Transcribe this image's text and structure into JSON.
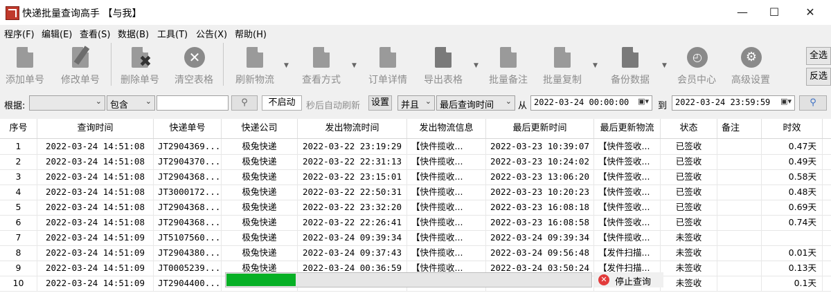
{
  "window": {
    "title": "快递批量查询高手  【与我】",
    "minimize_icon": "minimize-icon",
    "maximize_icon": "maximize-icon",
    "close_icon": "close-icon"
  },
  "menu": [
    "程序(F)",
    "编辑(E)",
    "查看(S)",
    "数据(B)",
    "工具(T)",
    "公告(X)",
    "帮助(H)"
  ],
  "toolbar": {
    "buttons": [
      {
        "label": "添加单号",
        "icon": "add-doc-icon"
      },
      {
        "label": "修改单号",
        "icon": "edit-doc-icon"
      },
      {
        "label": "删除单号",
        "icon": "delete-doc-icon"
      },
      {
        "label": "清空表格",
        "icon": "clear-table-icon"
      },
      {
        "label": "刷新物流",
        "icon": "refresh-doc-icon"
      },
      {
        "label": "查看方式",
        "icon": "view-mode-icon"
      },
      {
        "label": "订单详情",
        "icon": "order-detail-icon"
      },
      {
        "label": "导出表格",
        "icon": "export-icon"
      },
      {
        "label": "批量备注",
        "icon": "batch-note-icon"
      },
      {
        "label": "批量复制",
        "icon": "batch-copy-icon"
      },
      {
        "label": "备份数据",
        "icon": "backup-icon"
      },
      {
        "label": "会员中心",
        "icon": "member-icon"
      },
      {
        "label": "高级设置",
        "icon": "settings-gear-icon"
      }
    ],
    "select_all": "全选",
    "invert_select": "反选"
  },
  "filter": {
    "label": "根据:",
    "field_value": "",
    "match_value": "包含",
    "keyword_value": "",
    "search_icon": "search-icon",
    "auto_refresh_value": "不启动",
    "auto_refresh_label": "秒后自动刷新",
    "settings_button": "设置",
    "logic_value": "并且",
    "time_field_value": "最后查询时间",
    "from_label": "从",
    "from_value": "2022-03-24 00:00:00",
    "to_label": "到",
    "to_value": "2022-03-24 23:59:59"
  },
  "table": {
    "headers": [
      "序号",
      "查询时间",
      "快递单号",
      "快递公司",
      "发出物流时间",
      "发出物流信息",
      "最后更新时间",
      "最后更新物流",
      "状态",
      "备注",
      "时效"
    ],
    "rows": [
      [
        "1",
        "2022-03-24 14:51:08",
        "JT2904369...",
        "极兔快递",
        "2022-03-22 23:19:29",
        "【快件揽收...",
        "2022-03-23 10:39:07",
        "【快件签收...",
        "已签收",
        "",
        "0.47天"
      ],
      [
        "2",
        "2022-03-24 14:51:08",
        "JT2904370...",
        "极兔快递",
        "2022-03-22 22:31:13",
        "【快件揽收...",
        "2022-03-23 10:24:02",
        "【快件签收...",
        "已签收",
        "",
        "0.49天"
      ],
      [
        "3",
        "2022-03-24 14:51:08",
        "JT2904368...",
        "极兔快递",
        "2022-03-22 23:15:01",
        "【快件揽收...",
        "2022-03-23 13:06:20",
        "【快件签收...",
        "已签收",
        "",
        "0.58天"
      ],
      [
        "4",
        "2022-03-24 14:51:08",
        "JT3000172...",
        "极兔快递",
        "2022-03-22 22:50:31",
        "【快件揽收...",
        "2022-03-23 10:20:23",
        "【快件签收...",
        "已签收",
        "",
        "0.48天"
      ],
      [
        "5",
        "2022-03-24 14:51:08",
        "JT2904368...",
        "极兔快递",
        "2022-03-22 23:32:20",
        "【快件揽收...",
        "2022-03-23 16:08:18",
        "【快件签收...",
        "已签收",
        "",
        "0.69天"
      ],
      [
        "6",
        "2022-03-24 14:51:08",
        "JT2904368...",
        "极兔快递",
        "2022-03-22 22:26:41",
        "【快件揽收...",
        "2022-03-23 16:08:58",
        "【快件签收...",
        "已签收",
        "",
        "0.74天"
      ],
      [
        "7",
        "2022-03-24 14:51:09",
        "JT5107560...",
        "极兔快递",
        "2022-03-24 09:39:34",
        "【快件揽收...",
        "2022-03-24 09:39:34",
        "【快件揽收...",
        "未签收",
        "",
        ""
      ],
      [
        "8",
        "2022-03-24 14:51:09",
        "JT2904380...",
        "极兔快递",
        "2022-03-24 09:37:43",
        "【快件揽收...",
        "2022-03-24 09:56:48",
        "【发件扫描...",
        "未签收",
        "",
        "0.01天"
      ],
      [
        "9",
        "2022-03-24 14:51:09",
        "JT0005239...",
        "极兔快递",
        "2022-03-24 00:36:59",
        "【快件揽收...",
        "2022-03-24 03:50:24",
        "【发件扫描...",
        "未签收",
        "",
        "0.13天"
      ],
      [
        "10",
        "2022-03-24 14:51:09",
        "JT2904400...",
        "极兔快递",
        "",
        "",
        "",
        "",
        "未签收",
        "",
        "0.1天"
      ]
    ]
  },
  "progress": {
    "fraction": 0.19,
    "stop_label": "停止查询",
    "stop_icon": "stop-icon"
  },
  "colors": {
    "progress": "#06b025",
    "stop": "#e23b3b"
  }
}
